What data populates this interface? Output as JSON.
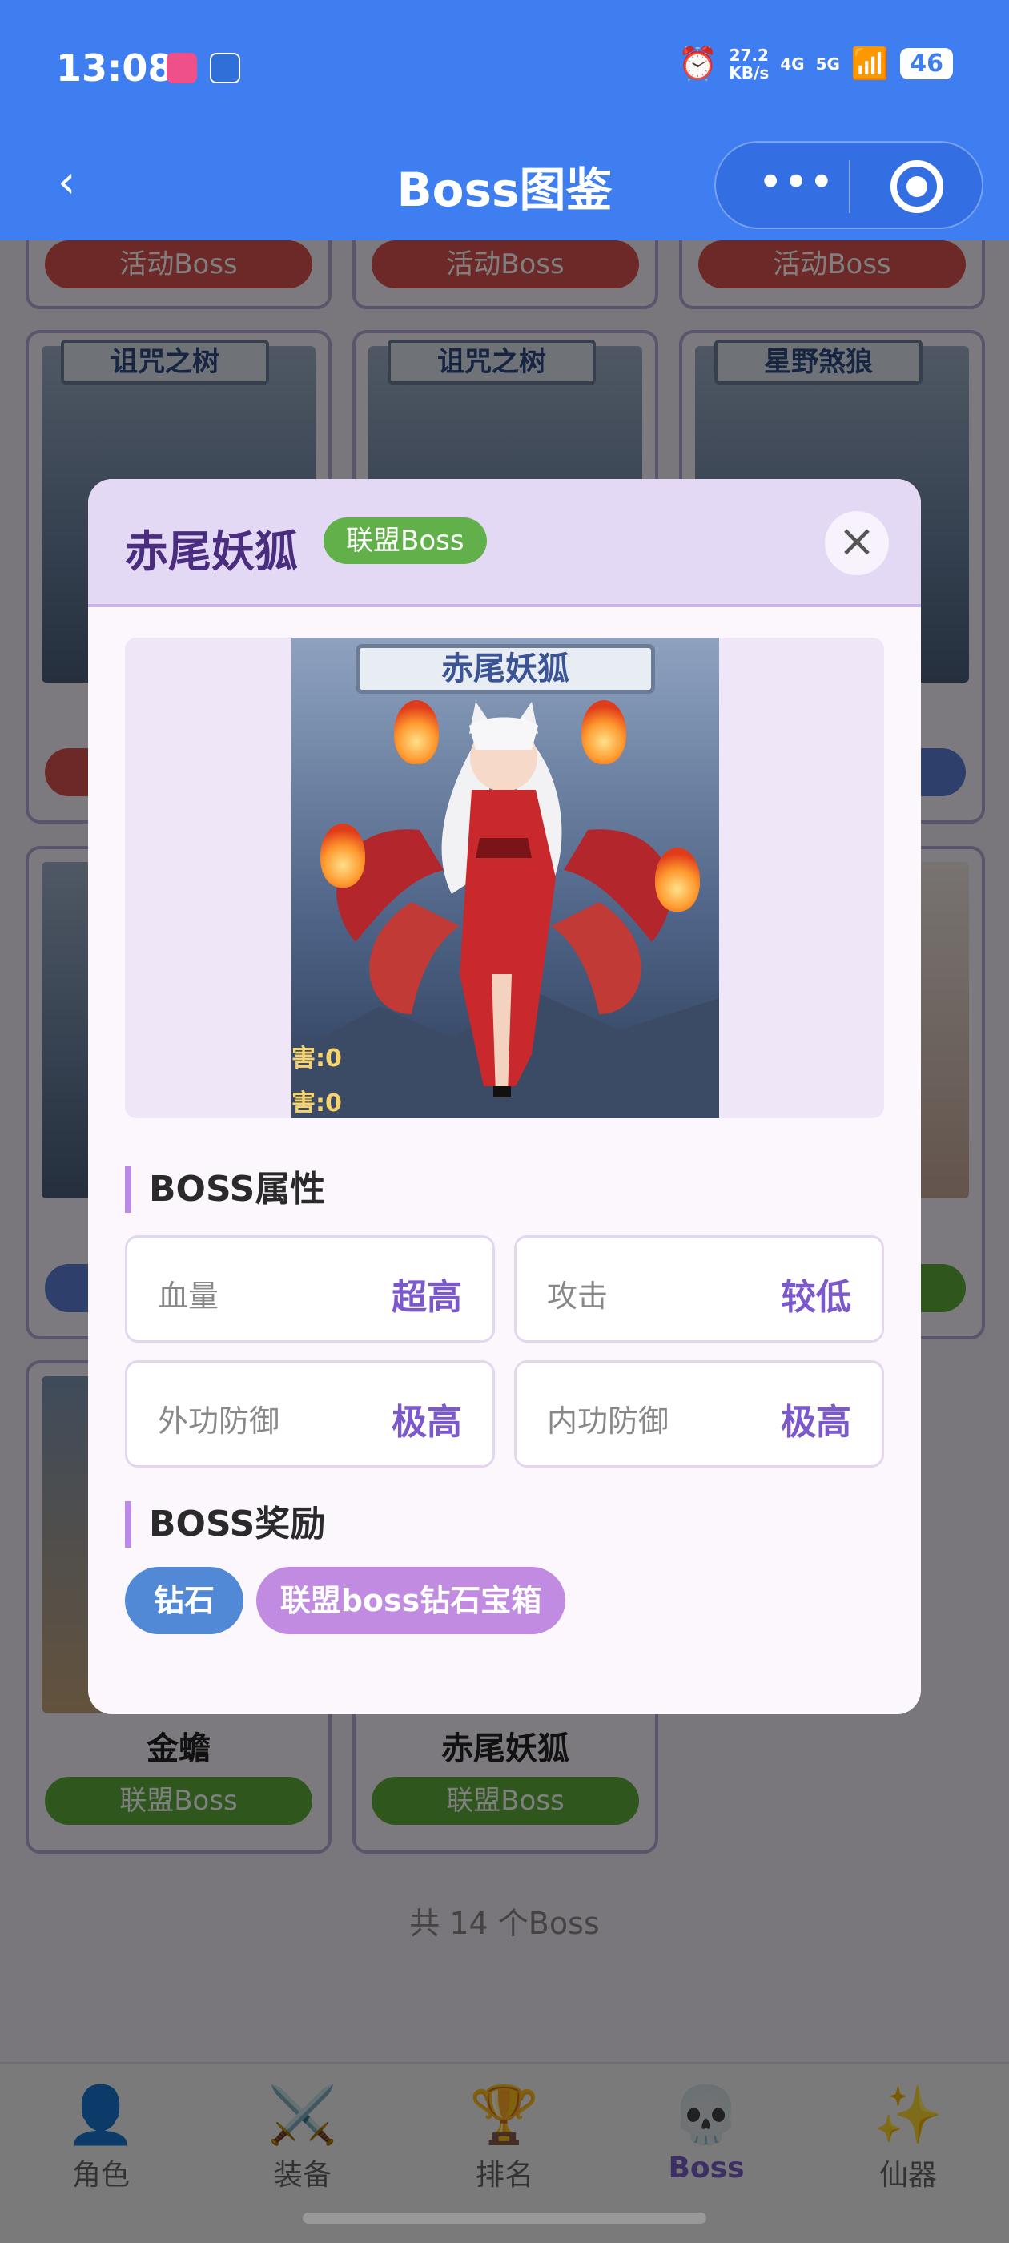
{
  "status_bar": {
    "time": "13:08",
    "speed_top": "27.2",
    "speed_unit": "KB/s",
    "net1": "4G",
    "net2": "5G",
    "battery": "46"
  },
  "nav": {
    "title": "Boss图鉴",
    "back_icon": "chevron-left-icon",
    "more_icon": "more-dots-icon",
    "target_icon": "record-target-icon"
  },
  "grid": {
    "row0_tags": [
      "活动Boss",
      "活动Boss",
      "活动Boss"
    ],
    "cards": [
      {
        "banner": "诅咒之树",
        "tag_color": "red"
      },
      {
        "banner": "诅咒之树",
        "tag_color": "red"
      },
      {
        "banner": "星野煞狼",
        "tag_color": "blue"
      }
    ],
    "bottom_cards": [
      {
        "name": "金蟾",
        "tag": "联盟Boss"
      },
      {
        "name": "赤尾妖狐",
        "tag": "联盟Boss"
      }
    ],
    "count_text": "共 14 个Boss"
  },
  "modal": {
    "title": "赤尾妖狐",
    "badge": "联盟Boss",
    "close_icon": "close-icon",
    "art_banner": "赤尾妖狐",
    "art_stat1": "害:0",
    "art_stat2": "害:0",
    "attr_section": "BOSS属性",
    "attrs": [
      {
        "name": "血量",
        "value": "超高"
      },
      {
        "name": "攻击",
        "value": "较低"
      },
      {
        "name": "外功防御",
        "value": "极高"
      },
      {
        "name": "内功防御",
        "value": "极高"
      }
    ],
    "reward_section": "BOSS奖励",
    "rewards": [
      "钻石",
      "联盟boss钻石宝箱"
    ]
  },
  "tabbar": {
    "items": [
      {
        "label": "角色",
        "icon": "👤"
      },
      {
        "label": "装备",
        "icon": "⚔️"
      },
      {
        "label": "排名",
        "icon": "🏆"
      },
      {
        "label": "Boss",
        "icon": "💀"
      },
      {
        "label": "仙器",
        "icon": "✨"
      }
    ],
    "active": "Boss"
  },
  "colors": {
    "brand": "#3f7ef0",
    "accent": "#7b58cc",
    "badge_green": "#62b04a",
    "reward_blue": "#5289d6",
    "reward_purple": "#c08be0"
  }
}
